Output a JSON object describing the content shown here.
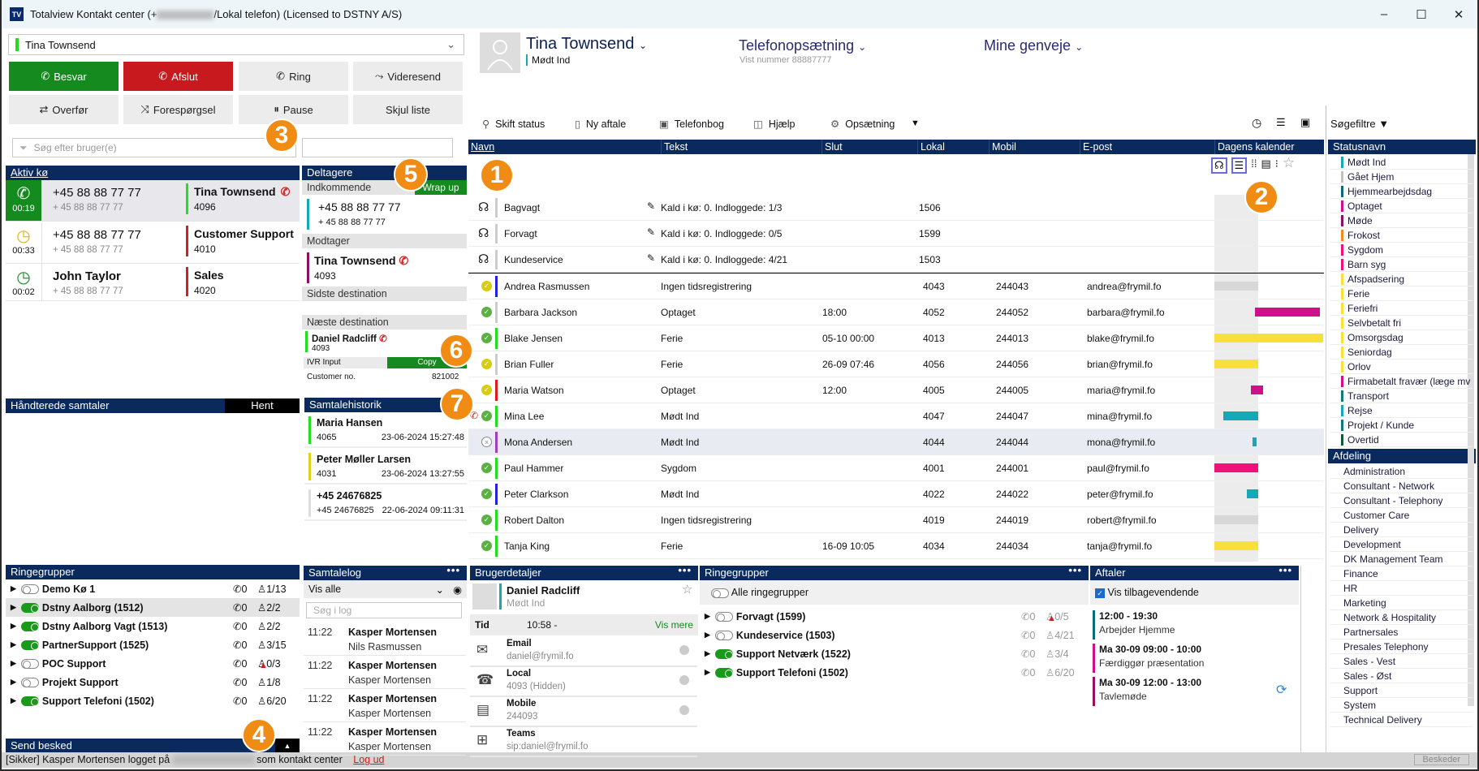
{
  "window": {
    "title_prefix": "Totalview Kontakt center (+",
    "title_suffix": "/Lokal telefon) (Licensed to DSTNY A/S)",
    "logo": "TV",
    "minimize": "–",
    "maximize": "☐",
    "close": "✕"
  },
  "left": {
    "user_select": "Tina Townsend",
    "buttons": [
      {
        "label": "Besvar",
        "icon": "phone-icon",
        "style": "green"
      },
      {
        "label": "Afslut",
        "icon": "hangup-icon",
        "style": "red"
      },
      {
        "label": "Ring",
        "icon": "dial-icon",
        "style": "gray"
      },
      {
        "label": "Videresend",
        "icon": "forward-icon",
        "style": "gray"
      },
      {
        "label": "Overfør",
        "icon": "transfer-icon",
        "style": "gray"
      },
      {
        "label": "Forespørgsel",
        "icon": "shuffle-icon",
        "style": "gray"
      },
      {
        "label": "Pause",
        "icon": "pause-icon",
        "style": "gray"
      },
      {
        "label": "Skjul liste",
        "icon": "",
        "style": "gray"
      }
    ],
    "search_placeholder": "Søg efter bruger(e)",
    "active_queue": {
      "title": "Aktiv kø",
      "rows": [
        {
          "time": "00:19",
          "number": "+45 88 88 77 77",
          "sub": "+ 45 88 88 77 77",
          "name": "Tina Townsend",
          "ext": "4096",
          "color": "#22dd22",
          "state": "active"
        },
        {
          "time": "00:33",
          "number": "+45 88 88 77 77",
          "sub": "+ 45 88 88 77 77",
          "name": "Customer Support",
          "ext": "4010",
          "color": "#d42020",
          "state": "waiting-yellow"
        },
        {
          "time": "00:02",
          "number": "John Taylor",
          "sub": "+ 45 88 88 77 77",
          "name": "Sales",
          "ext": "4020",
          "color": "#d42020",
          "state": "waiting-green"
        }
      ]
    },
    "handled": {
      "title": "Håndterede samtaler",
      "fetch": "Hent"
    },
    "ring_groups": {
      "title": "Ringegrupper",
      "rows": [
        {
          "name": "Demo Kø 1",
          "on": false,
          "calls": "0",
          "agents": "1/13",
          "warn": false
        },
        {
          "name": "Dstny Aalborg (1512)",
          "on": true,
          "calls": "0",
          "agents": "2/2",
          "warn": false
        },
        {
          "name": "Dstny Aalborg Vagt (1513)",
          "on": true,
          "calls": "0",
          "agents": "2/2",
          "warn": false
        },
        {
          "name": "PartnerSupport (1525)",
          "on": true,
          "calls": "0",
          "agents": "3/15",
          "warn": false
        },
        {
          "name": "POC Support",
          "on": false,
          "calls": "0",
          "agents": "0/3",
          "warn": true
        },
        {
          "name": "Projekt Support",
          "on": false,
          "calls": "0",
          "agents": "1/8",
          "warn": false
        },
        {
          "name": "Support Telefoni (1502)",
          "on": true,
          "calls": "0",
          "agents": "6/20",
          "warn": false
        }
      ]
    },
    "send_message": "Send besked"
  },
  "participants": {
    "title": "Deltagere",
    "wrap_up": "Wrap up",
    "incoming_label": "Indkommende",
    "incoming_number": "+45 88 88 77 77",
    "incoming_sub": "+ 45 88 88 77 77",
    "receiver_label": "Modtager",
    "receiver_name": "Tina Townsend",
    "receiver_ext": "4093",
    "last_dest_label": "Sidste destination",
    "next_dest_label": "Næste destination",
    "next_name": "Daniel Radcliff",
    "next_ext": "4093",
    "ivr_label": "IVR Input",
    "copy": "Copy",
    "customer_label": "Customer no.",
    "customer_value": "821002"
  },
  "history": {
    "title": "Samtalehistorik",
    "items": [
      {
        "name": "Maria Hansen",
        "sub": "4065",
        "date": "23-06-2024 15:27:48",
        "color": "#22dd22"
      },
      {
        "name": "Peter Møller Larsen",
        "sub": "4031",
        "date": "23-06-2024 13:27:55",
        "color": "#e0d020"
      },
      {
        "name": "+45 24676825",
        "sub": "+45 24676825",
        "date": "22-06-2024 09:11:31",
        "color": "#dddddd"
      }
    ]
  },
  "call_log": {
    "title": "Samtalelog",
    "filter": "Vis alle",
    "search_placeholder": "Søg i log",
    "items": [
      {
        "time": "11:22",
        "name": "Kasper Mortensen",
        "sub": "Nils Rasmussen"
      },
      {
        "time": "11:22",
        "name": "Kasper Mortensen",
        "sub": "Kasper Mortensen"
      },
      {
        "time": "11:22",
        "name": "Kasper Mortensen",
        "sub": "Kasper Mortensen"
      },
      {
        "time": "11:22",
        "name": "Kasper Mortensen",
        "sub": "Kasper Mortensen"
      }
    ]
  },
  "header": {
    "user": "Tina Townsend",
    "status": "Mødt Ind",
    "phone_setup": "Telefonopsætning",
    "shown_number": "Vist nummer 88887777",
    "shortcuts": "Mine genveje"
  },
  "toolbar": {
    "items": [
      {
        "label": "Skift status",
        "icon": "change-status-icon",
        "glyph": "⚲"
      },
      {
        "label": "Ny aftale",
        "icon": "calendar-icon",
        "glyph": "▯"
      },
      {
        "label": "Telefonbog",
        "icon": "phonebook-icon",
        "glyph": "▣"
      },
      {
        "label": "Hjælp",
        "icon": "help-book-icon",
        "glyph": "◫"
      },
      {
        "label": "Opsætning",
        "icon": "gear-icon",
        "glyph": "⚙"
      }
    ],
    "more": "▼",
    "search_filters": "Søgefiltre"
  },
  "table": {
    "columns": [
      "Navn",
      "Tekst",
      "Slut",
      "Lokal",
      "Mobil",
      "E-post",
      "Dagens kalender"
    ],
    "queues": [
      {
        "name": "Bagvagt",
        "text": "Kald i kø: 0. Indloggede: 1/3",
        "local": "1506"
      },
      {
        "name": "Forvagt",
        "text": "Kald i kø: 0. Indloggede: 0/5",
        "local": "1599"
      },
      {
        "name": "Kundeservice",
        "text": "Kald i kø: 0. Indloggede: 4/21",
        "local": "1503"
      }
    ],
    "users": [
      {
        "name": "Andrea Rasmussen",
        "text": "Ingen tidsregistrering",
        "end": "",
        "local": "4043",
        "mobile": "244043",
        "email": "andrea@frymil.fo",
        "presence": "yellow",
        "bar": "#2222dd",
        "cal": "#d8d8d8",
        "on_call": false
      },
      {
        "name": "Barbara Jackson",
        "text": "Optaget",
        "end": "18:00",
        "local": "4052",
        "mobile": "244052",
        "email": "barbara@frymil.fo",
        "presence": "green",
        "bar": "#cccccc",
        "cal": "#d0108a",
        "on_call": false
      },
      {
        "name": "Blake Jensen",
        "text": "Ferie",
        "end": "05-10 00:00",
        "local": "4013",
        "mobile": "244013",
        "email": "blake@frymil.fo",
        "presence": "green",
        "bar": "#22dd22",
        "cal": "#f7e03a",
        "on_call": false
      },
      {
        "name": "Brian Fuller",
        "text": "Ferie",
        "end": "26-09 07:46",
        "local": "4056",
        "mobile": "244056",
        "email": "brian@frymil.fo",
        "presence": "yellow",
        "bar": "#cccccc",
        "cal": "#f7e03a",
        "on_call": false
      },
      {
        "name": "Maria Watson",
        "text": "Optaget",
        "end": "12:00",
        "local": "4005",
        "mobile": "244005",
        "email": "maria@frymil.fo",
        "presence": "yellow",
        "bar": "#e01b1b",
        "cal": "#d0108a",
        "on_call": false
      },
      {
        "name": "Mina Lee",
        "text": "Mødt Ind",
        "end": "",
        "local": "4047",
        "mobile": "244047",
        "email": "mina@frymil.fo",
        "presence": "green",
        "bar": "#22dd22",
        "cal": "#17a8b8",
        "on_call": true
      },
      {
        "name": "Mona Andersen",
        "text": "Mødt Ind",
        "end": "",
        "local": "4044",
        "mobile": "244044",
        "email": "mona@frymil.fo",
        "presence": "offline",
        "bar": "#a040c0",
        "cal": "#17a8b8",
        "on_call": false
      },
      {
        "name": "Paul Hammer",
        "text": "Sygdom",
        "end": "",
        "local": "4001",
        "mobile": "244001",
        "email": "paul@frymil.fo",
        "presence": "green",
        "bar": "#22dd22",
        "cal": "#f0107a",
        "on_call": false
      },
      {
        "name": "Peter Clarkson",
        "text": "Mødt Ind",
        "end": "",
        "local": "4022",
        "mobile": "244022",
        "email": "peter@frymil.fo",
        "presence": "green",
        "bar": "#2222dd",
        "cal": "#17a8b8",
        "on_call": false
      },
      {
        "name": "Robert Dalton",
        "text": "Ingen tidsregistrering",
        "end": "",
        "local": "4019",
        "mobile": "244019",
        "email": "robert@frymil.fo",
        "presence": "green",
        "bar": "#22dd22",
        "cal": "#d8d8d8",
        "on_call": false
      },
      {
        "name": "Tanja King",
        "text": "Ferie",
        "end": "16-09 10:05",
        "local": "4034",
        "mobile": "244034",
        "email": "tanja@frymil.fo",
        "presence": "green",
        "bar": "#22dd22",
        "cal": "#f7e03a",
        "on_call": false
      }
    ]
  },
  "user_details": {
    "title": "Brugerdetaljer",
    "name": "Daniel Radcliff",
    "status": "Mødt Ind",
    "time_label": "Tid",
    "time_value": "10:58 -",
    "more": "Vis mere",
    "rows": [
      {
        "label": "Email",
        "value": "daniel@frymil.fo",
        "icon": "email-icon",
        "glyph": "✉"
      },
      {
        "label": "Local",
        "value": "4093 (Hidden)",
        "icon": "desk-phone-icon",
        "glyph": "☎"
      },
      {
        "label": "Mobile",
        "value": "244093",
        "icon": "mobile-icon",
        "glyph": "▤"
      },
      {
        "label": "Teams",
        "value": "sip:daniel@frymil.fo",
        "icon": "teams-icon",
        "glyph": "⊞"
      }
    ]
  },
  "ring_groups_panel": {
    "title": "Ringegrupper",
    "all": "Alle ringegrupper",
    "rows": [
      {
        "name": "Forvagt (1599)",
        "on": false,
        "calls": "0",
        "agents": "0/5",
        "warn": true
      },
      {
        "name": "Kundeservice (1503)",
        "on": false,
        "calls": "0",
        "agents": "4/21",
        "warn": false
      },
      {
        "name": "Support Netværk (1522)",
        "on": true,
        "calls": "0",
        "agents": "3/4",
        "warn": false
      },
      {
        "name": "Support Telefoni (1502)",
        "on": true,
        "calls": "0",
        "agents": "6/20",
        "warn": false
      }
    ]
  },
  "appointments": {
    "title": "Aftaler",
    "show_recurring": "Vis tilbagevendende",
    "show_recurring_checked": true,
    "items": [
      {
        "time": "12:00 - 19:30",
        "text": "Arbejder Hjemme",
        "color": "#0e6a7a"
      },
      {
        "time": "Ma 30-09  09:00 - 10:00",
        "text": "Færdiggør præsentation",
        "color": "#d0108a"
      },
      {
        "time": "Ma 30-09  12:00 - 13:00",
        "text": "Tavlemøde",
        "color": "#9a1060",
        "recurring": true
      }
    ]
  },
  "sidebar": {
    "status_title": "Statusnavn",
    "statuses": [
      {
        "name": "Mødt Ind",
        "color": "#17a8b8"
      },
      {
        "name": "Gået Hjem",
        "color": "#c0c0c0"
      },
      {
        "name": "Hjemmearbejdsdag",
        "color": "#0e6a7a"
      },
      {
        "name": "Optaget",
        "color": "#d0108a"
      },
      {
        "name": "Møde",
        "color": "#8a1060"
      },
      {
        "name": "Frokost",
        "color": "#f08c20"
      },
      {
        "name": "Sygdom",
        "color": "#f0107a"
      },
      {
        "name": "Barn syg",
        "color": "#f0107a"
      },
      {
        "name": "Afspadsering",
        "color": "#f7e03a"
      },
      {
        "name": "Ferie",
        "color": "#f7e03a"
      },
      {
        "name": "Feriefri",
        "color": "#f7e03a"
      },
      {
        "name": "Selvbetalt fri",
        "color": "#f7e03a"
      },
      {
        "name": "Omsorgsdag",
        "color": "#f7e03a"
      },
      {
        "name": "Seniordag",
        "color": "#f7e03a"
      },
      {
        "name": "Orlov",
        "color": "#f7e03a"
      },
      {
        "name": "Firmabetalt fravær (læge mv",
        "color": "#d0108a"
      },
      {
        "name": "Transport",
        "color": "#0e7a7a"
      },
      {
        "name": "Rejse",
        "color": "#17a8b8"
      },
      {
        "name": "Projekt / Kunde",
        "color": "#0e7a7a"
      },
      {
        "name": "Overtid",
        "color": "#0e5a3a"
      }
    ],
    "dept_title": "Afdeling",
    "departments": [
      "Administration",
      "Consultant - Network",
      "Consultant - Telephony",
      "Customer Care",
      "Delivery",
      "Development",
      "DK Management Team",
      "Finance",
      "HR",
      "Marketing",
      "Network & Hospitality",
      "Partnersales",
      "Presales Telephony",
      "Sales - Vest",
      "Sales - Øst",
      "Support",
      "System",
      "Technical Delivery"
    ]
  },
  "status_bar": {
    "prefix": "[Sikker] Kasper Mortensen logget på",
    "suffix": "som kontakt center",
    "logout": "Log ud",
    "messages": "Beskeder"
  },
  "callouts": [
    "1",
    "2",
    "3",
    "4",
    "5",
    "6",
    "7"
  ]
}
